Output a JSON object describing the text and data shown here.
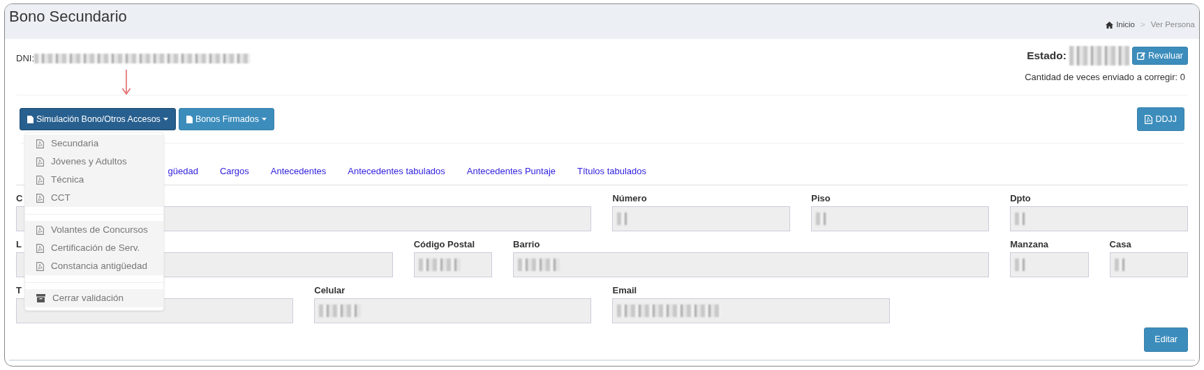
{
  "header": {
    "title": "Bono Secundario",
    "breadcrumb_separator": ">",
    "breadcrumb": [
      {
        "label": "Inicio",
        "kind": "home"
      },
      {
        "label": "Ver Persona",
        "kind": "current"
      }
    ]
  },
  "person": {
    "dni_label": "DNI:",
    "dni_redacted": true,
    "estado_label": "Estado:",
    "estado_redacted": true,
    "revaluar": "Revaluar",
    "correcciones": "Cantidad de veces enviado a corregir: 0"
  },
  "actions": [
    {
      "label": "Simulación Bono/Otros Accesos",
      "open": true
    },
    {
      "label": "Bonos Firmados",
      "open": false
    }
  ],
  "ddjj": "DDJJ",
  "menu": {
    "groups": [
      {
        "items": [
          {
            "label": "Secundaria",
            "kind": "pdf"
          },
          {
            "label": "Jóvenes y Adultos",
            "kind": "pdf"
          },
          {
            "label": "Técnica",
            "kind": "pdf"
          },
          {
            "label": "CCT",
            "kind": "pdf"
          }
        ]
      },
      {
        "items": [
          {
            "label": "Volantes de Concursos",
            "kind": "pdf"
          },
          {
            "label": "Certificación de Serv.",
            "kind": "pdf"
          },
          {
            "label": "Constancia antigüedad",
            "kind": "pdf"
          }
        ]
      },
      {
        "items": [
          {
            "label": "Cerrar validación",
            "kind": "archive"
          }
        ]
      }
    ]
  },
  "tabs": [
    {
      "label": "güedad",
      "selected": false
    },
    {
      "label": "Cargos",
      "selected": false
    },
    {
      "label": "Antecedentes",
      "selected": false
    },
    {
      "label": "Antecedentes tabulados",
      "selected": false
    },
    {
      "label": "Antecedentes Puntaje",
      "selected": false
    },
    {
      "label": "Títulos tabulados",
      "selected": false
    }
  ],
  "fields": [
    {
      "label": "C",
      "redacted": false
    },
    {
      "label": "Número",
      "redacted": true
    },
    {
      "label": "Piso",
      "redacted": true
    },
    {
      "label": "Dpto",
      "redacted": true
    },
    {
      "label": "L",
      "redacted": false
    },
    {
      "label": "Código Postal",
      "redacted": true
    },
    {
      "label": "Barrio",
      "redacted": true
    },
    {
      "label": "Manzana",
      "redacted": true
    },
    {
      "label": "Casa",
      "redacted": true
    },
    {
      "label": "T",
      "redacted": false
    },
    {
      "label": "Celular",
      "redacted": true
    },
    {
      "label": "Email",
      "redacted": true
    }
  ],
  "edit_button": "Editar"
}
